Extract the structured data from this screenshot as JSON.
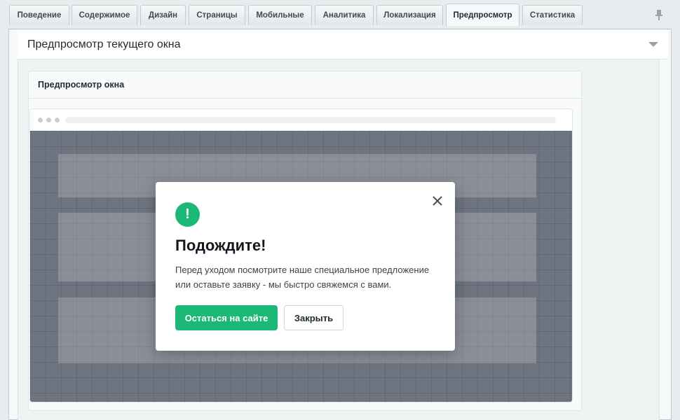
{
  "tabs": [
    {
      "label": "Поведение"
    },
    {
      "label": "Содержимое"
    },
    {
      "label": "Дизайн"
    },
    {
      "label": "Страницы"
    },
    {
      "label": "Мобильные"
    },
    {
      "label": "Аналитика"
    },
    {
      "label": "Локализация"
    },
    {
      "label": "Предпросмотр",
      "active": true
    },
    {
      "label": "Статистика"
    }
  ],
  "section": {
    "title": "Предпросмотр текущего окна"
  },
  "card": {
    "title": "Предпросмотр окна"
  },
  "modal": {
    "icon": "!",
    "title": "Подождите!",
    "text": "Перед уходом посмотрите наше специальное предложение или оставьте заявку - мы быстро свяжемся с вами.",
    "primary_button": "Остаться на сайте",
    "secondary_button": "Закрыть"
  },
  "colors": {
    "accent": "#1cb878",
    "overlay": "#6f7580",
    "panel_bg": "#f5f9f9"
  }
}
